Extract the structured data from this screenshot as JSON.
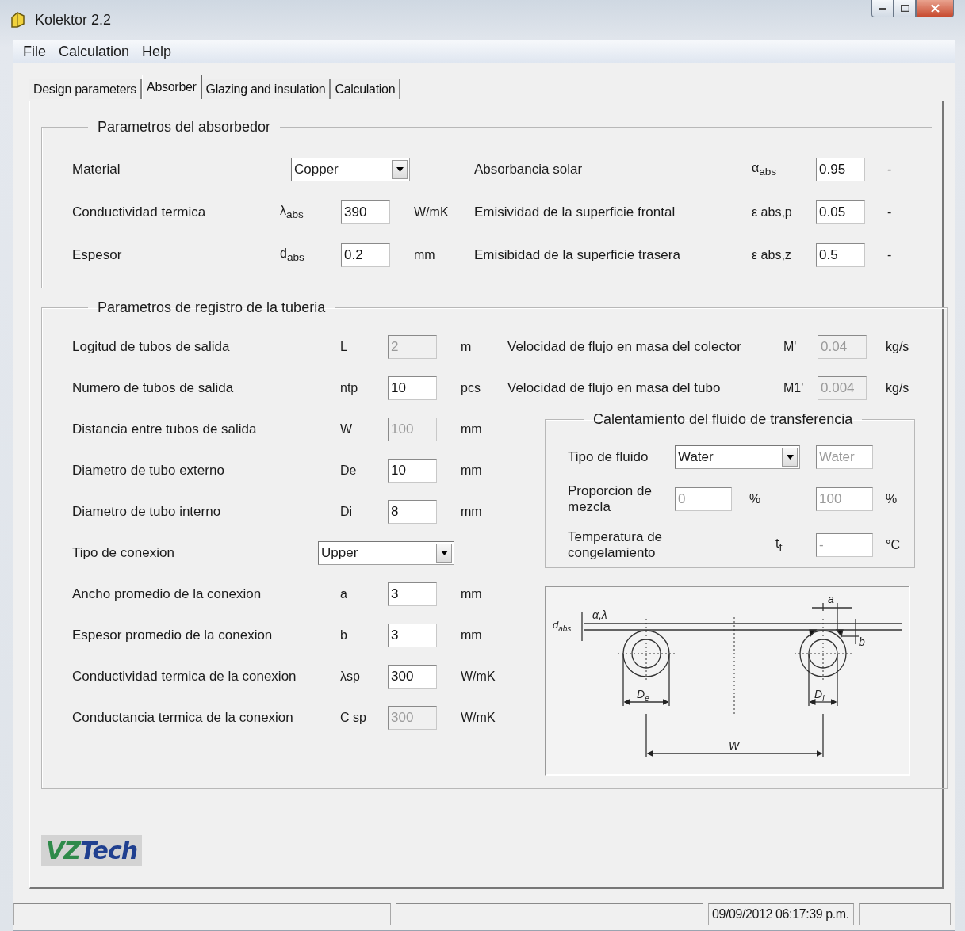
{
  "window": {
    "title": "Kolektor 2.2"
  },
  "menu": [
    "File",
    "Calculation",
    "Help"
  ],
  "tabs": [
    {
      "label": "Design parameters",
      "selected": false
    },
    {
      "label": "Absorber",
      "selected": true
    },
    {
      "label": "Glazing and insulation",
      "selected": false
    },
    {
      "label": "Calculation",
      "selected": false
    }
  ],
  "absorber_group": {
    "title": "Parametros del absorbedor",
    "left": [
      {
        "kind": "select",
        "label": "Material",
        "value": "Copper"
      },
      {
        "kind": "input",
        "label": "Conductividad termica",
        "symbol": "λ$_{abs}$",
        "value": "390",
        "unit": "W/mK",
        "disabled": false
      },
      {
        "kind": "input",
        "label": "Espesor",
        "symbol": "d$_{abs}$",
        "value": "0.2",
        "unit": "mm",
        "disabled": false
      }
    ],
    "right": [
      {
        "kind": "input",
        "label": "Absorbancia solar",
        "symbol": "α$_{abs}$",
        "value": "0.95",
        "unit": "-",
        "disabled": false
      },
      {
        "kind": "input",
        "label": "Emisividad de la superficie frontal",
        "symbol": "ε abs,p",
        "value": "0.05",
        "unit": "-",
        "disabled": false
      },
      {
        "kind": "input",
        "label": "Emisibidad de la superficie trasera",
        "symbol": "ε abs,z",
        "value": "0.5",
        "unit": "-",
        "disabled": false
      }
    ]
  },
  "pipe_group": {
    "title": "Parametros de registro de la tuberia",
    "left": [
      {
        "kind": "input",
        "label": "Logitud de tubos de salida",
        "symbol": "L",
        "value": "2",
        "unit": "m",
        "disabled": true
      },
      {
        "kind": "input",
        "label": "Numero de tubos de salida",
        "symbol": "ntp",
        "value": "10",
        "unit": "pcs",
        "disabled": false
      },
      {
        "kind": "input",
        "label": "Distancia entre tubos de salida",
        "symbol": "W",
        "value": "100",
        "unit": "mm",
        "disabled": true
      },
      {
        "kind": "input",
        "label": "Diametro de tubo externo",
        "symbol": "De",
        "value": "10",
        "unit": "mm",
        "disabled": false
      },
      {
        "kind": "input",
        "label": "Diametro de tubo interno",
        "symbol": "Di",
        "value": "8",
        "unit": "mm",
        "disabled": false
      },
      {
        "kind": "select",
        "label": "Tipo de conexion",
        "value": "Upper"
      },
      {
        "kind": "input",
        "label": "Ancho promedio de la conexion",
        "symbol": "a",
        "value": "3",
        "unit": "mm",
        "disabled": false
      },
      {
        "kind": "input",
        "label": "Espesor promedio de la conexion",
        "symbol": "b",
        "value": "3",
        "unit": "mm",
        "disabled": false
      },
      {
        "kind": "input",
        "label": "Conductividad termica de la conexion",
        "symbol": "λsp",
        "value": "300",
        "unit": "W/mK",
        "disabled": false
      },
      {
        "kind": "input",
        "label": "Conductancia termica de la conexion",
        "symbol": "C sp",
        "value": "300",
        "unit": "W/mK",
        "disabled": true
      }
    ],
    "flow": [
      {
        "kind": "input",
        "label": "Velocidad de flujo en masa del colector",
        "symbol": "M'",
        "value": "0.04",
        "unit": "kg/s",
        "disabled": true
      },
      {
        "kind": "input",
        "label": "Velocidad de flujo en masa del tubo",
        "symbol": "M1'",
        "value": "0.004",
        "unit": "kg/s",
        "disabled": true
      }
    ],
    "fluid_group": {
      "title": "Calentamiento del fluido de transferencia",
      "rows": [
        {
          "label": "Tipo de fluido",
          "field_1": {
            "kind": "select",
            "value": "Water"
          },
          "field_2": {
            "kind": "input",
            "value": "Water",
            "disabled": true
          }
        },
        {
          "label": "Proporcion de mezcla",
          "field_1": {
            "kind": "input",
            "value": "0",
            "disabled": true
          },
          "unit_1": "%",
          "field_2": {
            "kind": "input",
            "value": "100",
            "disabled": true
          },
          "unit_2": "%"
        },
        {
          "label": "Temperatura de congelamiento",
          "symbol": "t$_{f}$",
          "field_2": {
            "kind": "input",
            "value": "-",
            "disabled": true
          },
          "unit_2": "°C"
        }
      ]
    },
    "diagram": {
      "labels": [
        "d$_{abs}$",
        "α,λ",
        "a",
        "b",
        "D$_{e}$",
        "D$_{i}$",
        "W"
      ]
    }
  },
  "logo": [
    "VZ",
    "Tech"
  ],
  "status_bar": {
    "panel_3": "09/09/2012 06:17:39 p.m."
  }
}
